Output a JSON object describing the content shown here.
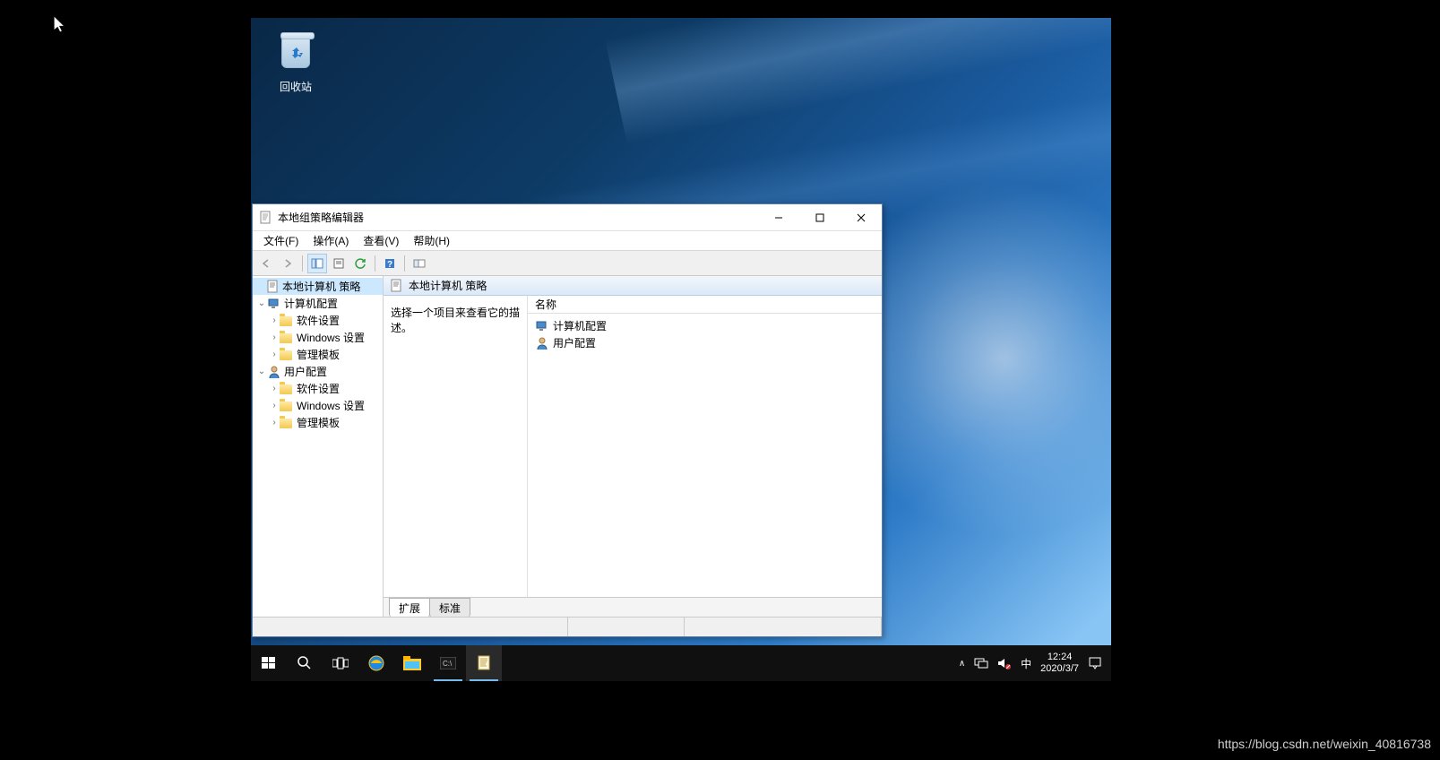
{
  "desktop": {
    "recycle_bin_label": "回收站"
  },
  "window": {
    "title": "本地组策略编辑器",
    "menus": {
      "file": "文件(F)",
      "action": "操作(A)",
      "view": "查看(V)",
      "help": "帮助(H)"
    },
    "tree": {
      "root": "本地计算机 策略",
      "computer_config": "计算机配置",
      "user_config": "用户配置",
      "software_settings": "软件设置",
      "windows_settings": "Windows 设置",
      "admin_templates": "管理模板"
    },
    "content": {
      "header": "本地计算机 策略",
      "description_prompt": "选择一个项目来查看它的描述。",
      "column_name": "名称",
      "items": {
        "computer_config": "计算机配置",
        "user_config": "用户配置"
      }
    },
    "tabs": {
      "extended": "扩展",
      "standard": "标准"
    }
  },
  "taskbar": {
    "time": "12:24",
    "date": "2020/3/7",
    "ime": "中"
  },
  "watermark": "https://blog.csdn.net/weixin_40816738"
}
